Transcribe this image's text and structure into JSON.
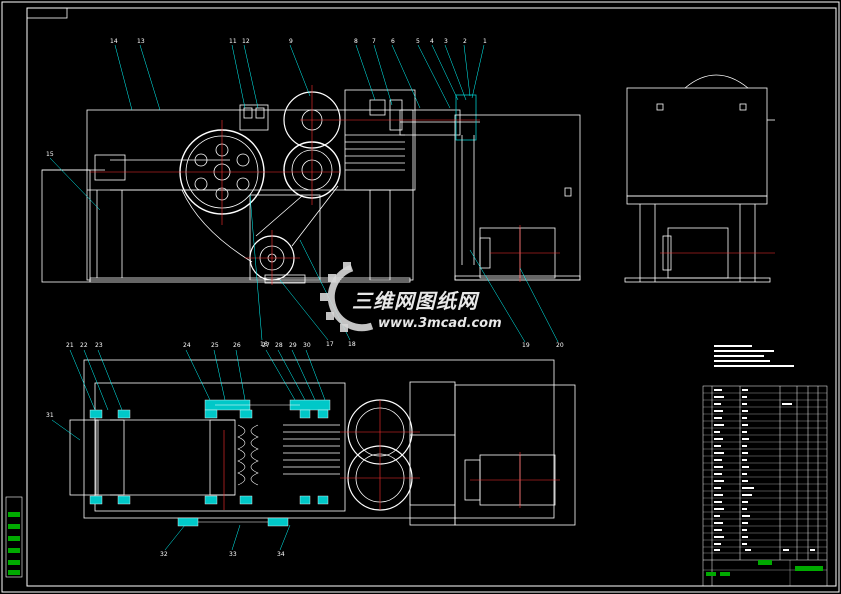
{
  "drawing": {
    "callouts_top": [
      "1",
      "2",
      "3",
      "4",
      "5",
      "6",
      "7",
      "8",
      "9",
      "10",
      "11",
      "12",
      "13",
      "14",
      "15",
      "16",
      "17",
      "18"
    ],
    "callouts_bottom": [
      "19",
      "20",
      "21",
      "22",
      "23",
      "24",
      "25",
      "26",
      "27",
      "28",
      "29",
      "30",
      "31",
      "32",
      "33",
      "34"
    ]
  },
  "watermark": {
    "brand": "三维网图纸网",
    "url": "www.3mcad.com"
  },
  "colors": {
    "outline": "#ffffff",
    "leader": "#00ffff",
    "centerline": "#ff3030",
    "accent_fill": "#00c8c8",
    "title_fill": "#00aa00"
  }
}
